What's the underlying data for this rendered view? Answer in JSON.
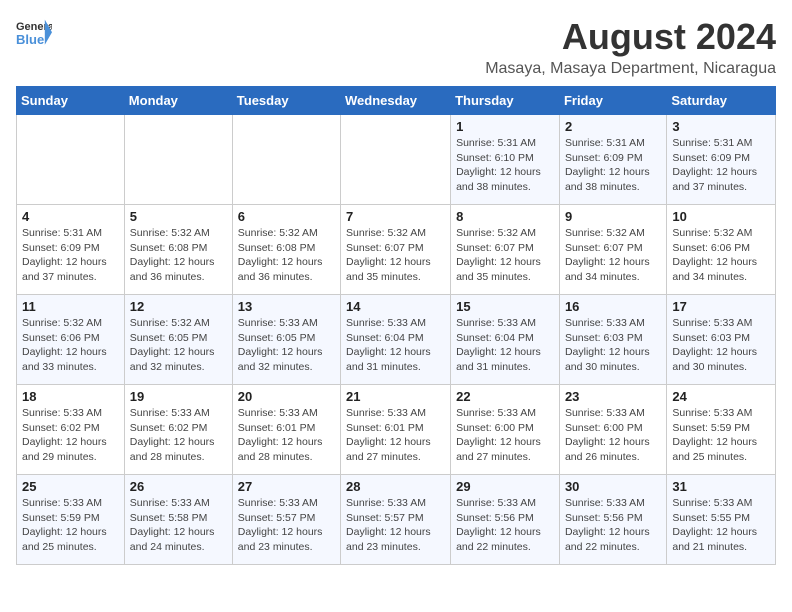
{
  "logo": {
    "line1": "General",
    "line2": "Blue"
  },
  "title": "August 2024",
  "subtitle": "Masaya, Masaya Department, Nicaragua",
  "weekdays": [
    "Sunday",
    "Monday",
    "Tuesday",
    "Wednesday",
    "Thursday",
    "Friday",
    "Saturday"
  ],
  "weeks": [
    [
      {
        "day": "",
        "detail": ""
      },
      {
        "day": "",
        "detail": ""
      },
      {
        "day": "",
        "detail": ""
      },
      {
        "day": "",
        "detail": ""
      },
      {
        "day": "1",
        "detail": "Sunrise: 5:31 AM\nSunset: 6:10 PM\nDaylight: 12 hours\nand 38 minutes."
      },
      {
        "day": "2",
        "detail": "Sunrise: 5:31 AM\nSunset: 6:09 PM\nDaylight: 12 hours\nand 38 minutes."
      },
      {
        "day": "3",
        "detail": "Sunrise: 5:31 AM\nSunset: 6:09 PM\nDaylight: 12 hours\nand 37 minutes."
      }
    ],
    [
      {
        "day": "4",
        "detail": "Sunrise: 5:31 AM\nSunset: 6:09 PM\nDaylight: 12 hours\nand 37 minutes."
      },
      {
        "day": "5",
        "detail": "Sunrise: 5:32 AM\nSunset: 6:08 PM\nDaylight: 12 hours\nand 36 minutes."
      },
      {
        "day": "6",
        "detail": "Sunrise: 5:32 AM\nSunset: 6:08 PM\nDaylight: 12 hours\nand 36 minutes."
      },
      {
        "day": "7",
        "detail": "Sunrise: 5:32 AM\nSunset: 6:07 PM\nDaylight: 12 hours\nand 35 minutes."
      },
      {
        "day": "8",
        "detail": "Sunrise: 5:32 AM\nSunset: 6:07 PM\nDaylight: 12 hours\nand 35 minutes."
      },
      {
        "day": "9",
        "detail": "Sunrise: 5:32 AM\nSunset: 6:07 PM\nDaylight: 12 hours\nand 34 minutes."
      },
      {
        "day": "10",
        "detail": "Sunrise: 5:32 AM\nSunset: 6:06 PM\nDaylight: 12 hours\nand 34 minutes."
      }
    ],
    [
      {
        "day": "11",
        "detail": "Sunrise: 5:32 AM\nSunset: 6:06 PM\nDaylight: 12 hours\nand 33 minutes."
      },
      {
        "day": "12",
        "detail": "Sunrise: 5:32 AM\nSunset: 6:05 PM\nDaylight: 12 hours\nand 32 minutes."
      },
      {
        "day": "13",
        "detail": "Sunrise: 5:33 AM\nSunset: 6:05 PM\nDaylight: 12 hours\nand 32 minutes."
      },
      {
        "day": "14",
        "detail": "Sunrise: 5:33 AM\nSunset: 6:04 PM\nDaylight: 12 hours\nand 31 minutes."
      },
      {
        "day": "15",
        "detail": "Sunrise: 5:33 AM\nSunset: 6:04 PM\nDaylight: 12 hours\nand 31 minutes."
      },
      {
        "day": "16",
        "detail": "Sunrise: 5:33 AM\nSunset: 6:03 PM\nDaylight: 12 hours\nand 30 minutes."
      },
      {
        "day": "17",
        "detail": "Sunrise: 5:33 AM\nSunset: 6:03 PM\nDaylight: 12 hours\nand 30 minutes."
      }
    ],
    [
      {
        "day": "18",
        "detail": "Sunrise: 5:33 AM\nSunset: 6:02 PM\nDaylight: 12 hours\nand 29 minutes."
      },
      {
        "day": "19",
        "detail": "Sunrise: 5:33 AM\nSunset: 6:02 PM\nDaylight: 12 hours\nand 28 minutes."
      },
      {
        "day": "20",
        "detail": "Sunrise: 5:33 AM\nSunset: 6:01 PM\nDaylight: 12 hours\nand 28 minutes."
      },
      {
        "day": "21",
        "detail": "Sunrise: 5:33 AM\nSunset: 6:01 PM\nDaylight: 12 hours\nand 27 minutes."
      },
      {
        "day": "22",
        "detail": "Sunrise: 5:33 AM\nSunset: 6:00 PM\nDaylight: 12 hours\nand 27 minutes."
      },
      {
        "day": "23",
        "detail": "Sunrise: 5:33 AM\nSunset: 6:00 PM\nDaylight: 12 hours\nand 26 minutes."
      },
      {
        "day": "24",
        "detail": "Sunrise: 5:33 AM\nSunset: 5:59 PM\nDaylight: 12 hours\nand 25 minutes."
      }
    ],
    [
      {
        "day": "25",
        "detail": "Sunrise: 5:33 AM\nSunset: 5:59 PM\nDaylight: 12 hours\nand 25 minutes."
      },
      {
        "day": "26",
        "detail": "Sunrise: 5:33 AM\nSunset: 5:58 PM\nDaylight: 12 hours\nand 24 minutes."
      },
      {
        "day": "27",
        "detail": "Sunrise: 5:33 AM\nSunset: 5:57 PM\nDaylight: 12 hours\nand 23 minutes."
      },
      {
        "day": "28",
        "detail": "Sunrise: 5:33 AM\nSunset: 5:57 PM\nDaylight: 12 hours\nand 23 minutes."
      },
      {
        "day": "29",
        "detail": "Sunrise: 5:33 AM\nSunset: 5:56 PM\nDaylight: 12 hours\nand 22 minutes."
      },
      {
        "day": "30",
        "detail": "Sunrise: 5:33 AM\nSunset: 5:56 PM\nDaylight: 12 hours\nand 22 minutes."
      },
      {
        "day": "31",
        "detail": "Sunrise: 5:33 AM\nSunset: 5:55 PM\nDaylight: 12 hours\nand 21 minutes."
      }
    ]
  ]
}
